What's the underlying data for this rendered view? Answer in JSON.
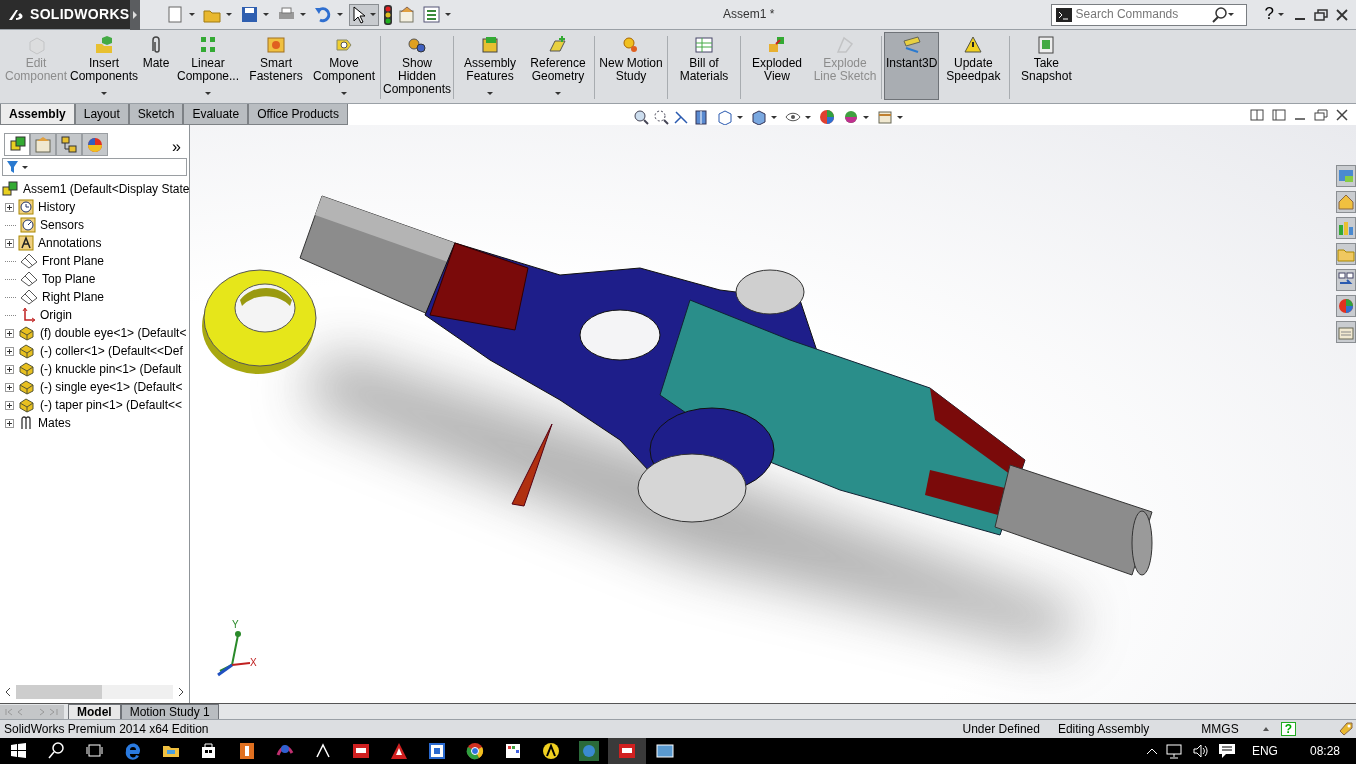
{
  "app": {
    "logo_text": "SOLIDWORKS",
    "document_title": "Assem1 *",
    "help_mark": "?"
  },
  "search": {
    "placeholder": "Search Commands"
  },
  "ribbon_groups": [
    [
      {
        "label": "Edit Component",
        "disabled": true,
        "selected": false,
        "dropdown": false
      },
      {
        "label": "Insert Components",
        "disabled": false,
        "selected": false,
        "dropdown": true
      },
      {
        "label": "Mate",
        "disabled": false,
        "selected": false,
        "dropdown": false
      },
      {
        "label": "Linear Compone...",
        "disabled": false,
        "selected": false,
        "dropdown": true
      },
      {
        "label": "Smart Fasteners",
        "disabled": false,
        "selected": false,
        "dropdown": false
      },
      {
        "label": "Move Component",
        "disabled": false,
        "selected": false,
        "dropdown": true
      }
    ],
    [
      {
        "label": "Show Hidden Components",
        "disabled": false,
        "selected": false,
        "dropdown": false
      }
    ],
    [
      {
        "label": "Assembly Features",
        "disabled": false,
        "selected": false,
        "dropdown": true
      },
      {
        "label": "Reference Geometry",
        "disabled": false,
        "selected": false,
        "dropdown": true
      }
    ],
    [
      {
        "label": "New Motion Study",
        "disabled": false,
        "selected": false,
        "dropdown": false
      }
    ],
    [
      {
        "label": "Bill of Materials",
        "disabled": false,
        "selected": false,
        "dropdown": false
      }
    ],
    [
      {
        "label": "Exploded View",
        "disabled": false,
        "selected": false,
        "dropdown": false
      },
      {
        "label": "Explode Line Sketch",
        "disabled": true,
        "selected": false,
        "dropdown": false
      }
    ],
    [
      {
        "label": "Instant3D",
        "disabled": false,
        "selected": true,
        "dropdown": false
      },
      {
        "label": "Update Speedpak",
        "disabled": false,
        "selected": false,
        "dropdown": false
      }
    ],
    [
      {
        "label": "Take Snapshot",
        "disabled": false,
        "selected": false,
        "dropdown": false
      }
    ]
  ],
  "command_tabs": [
    {
      "label": "Assembly",
      "selected": true
    },
    {
      "label": "Layout",
      "selected": false
    },
    {
      "label": "Sketch",
      "selected": false
    },
    {
      "label": "Evaluate",
      "selected": false
    },
    {
      "label": "Office Products",
      "selected": false
    }
  ],
  "feature_panel": {
    "tabs": [
      {
        "selected": true
      },
      {
        "selected": false
      },
      {
        "selected": false
      },
      {
        "selected": false
      }
    ],
    "more": "»",
    "tree": {
      "label": "Assem1  (Default<Display State",
      "kind": "assembly",
      "children": [
        {
          "label": "History",
          "kind": "history",
          "expanded": false
        },
        {
          "label": "Sensors",
          "kind": "sensors"
        },
        {
          "label": "Annotations",
          "kind": "annotations",
          "expanded": false
        },
        {
          "label": "Front Plane",
          "kind": "plane"
        },
        {
          "label": "Top Plane",
          "kind": "plane"
        },
        {
          "label": "Right Plane",
          "kind": "plane"
        },
        {
          "label": "Origin",
          "kind": "origin"
        },
        {
          "label": "(f) double eye<1> (Default<",
          "kind": "part",
          "expanded": false
        },
        {
          "label": "(-) coller<1> (Default<<Def",
          "kind": "part",
          "expanded": false
        },
        {
          "label": "(-) knuckle pin<1> (Default",
          "kind": "part",
          "expanded": false
        },
        {
          "label": "(-) single eye<1> (Default<",
          "kind": "part",
          "expanded": false
        },
        {
          "label": "(-) taper pin<1> (Default<<",
          "kind": "part",
          "expanded": false
        },
        {
          "label": "Mates",
          "kind": "mates",
          "expanded": false
        }
      ]
    }
  },
  "triad": {
    "x_label": "X",
    "y_label": "Y"
  },
  "bottom_tabs": [
    {
      "label": "Model",
      "selected": true
    },
    {
      "label": "Motion Study 1",
      "selected": false
    }
  ],
  "status_bar": {
    "edition": "SolidWorks Premium 2014 x64 Edition",
    "state": "Under Defined",
    "mode": "Editing Assembly",
    "units": "MMGS",
    "help_mark": "?"
  },
  "taskbar": {
    "language": "ENG",
    "time": "08:28"
  }
}
